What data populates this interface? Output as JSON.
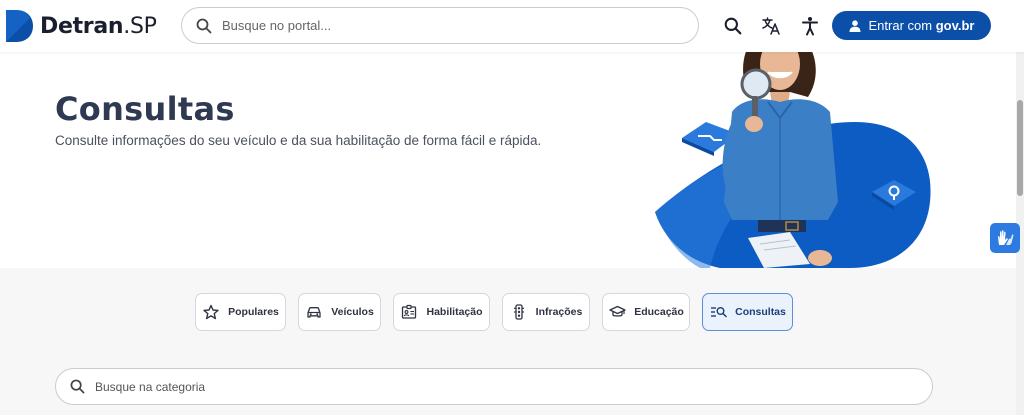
{
  "header": {
    "logo_text_bold": "Detran",
    "logo_text_light": ".SP",
    "search_placeholder": "Busque no portal...",
    "login_prefix": "Entrar com",
    "login_brand": "gov.br",
    "icons": [
      "search-icon",
      "translate-icon",
      "accessibility-icon",
      "user-icon"
    ]
  },
  "hero": {
    "title": "Consultas",
    "subtitle": "Consulte informações do seu veículo e da sua habilitação de forma fácil e rápida."
  },
  "tabs": [
    {
      "label": "Populares",
      "icon": "star-icon"
    },
    {
      "label": "Veículos",
      "icon": "car-icon"
    },
    {
      "label": "Habilitação",
      "icon": "id-card-icon"
    },
    {
      "label": "Infrações",
      "icon": "traffic-light-icon"
    },
    {
      "label": "Educação",
      "icon": "graduation-cap-icon"
    },
    {
      "label": "Consultas",
      "icon": "search-list-icon",
      "active": true
    }
  ],
  "category_search": {
    "placeholder": "Busque na categoria"
  },
  "colors": {
    "brand_blue": "#0b4fa8",
    "active_tab_bg": "#eaf2fc",
    "active_tab_border": "#5b8fd6",
    "widget_blue": "#2d7be0"
  }
}
